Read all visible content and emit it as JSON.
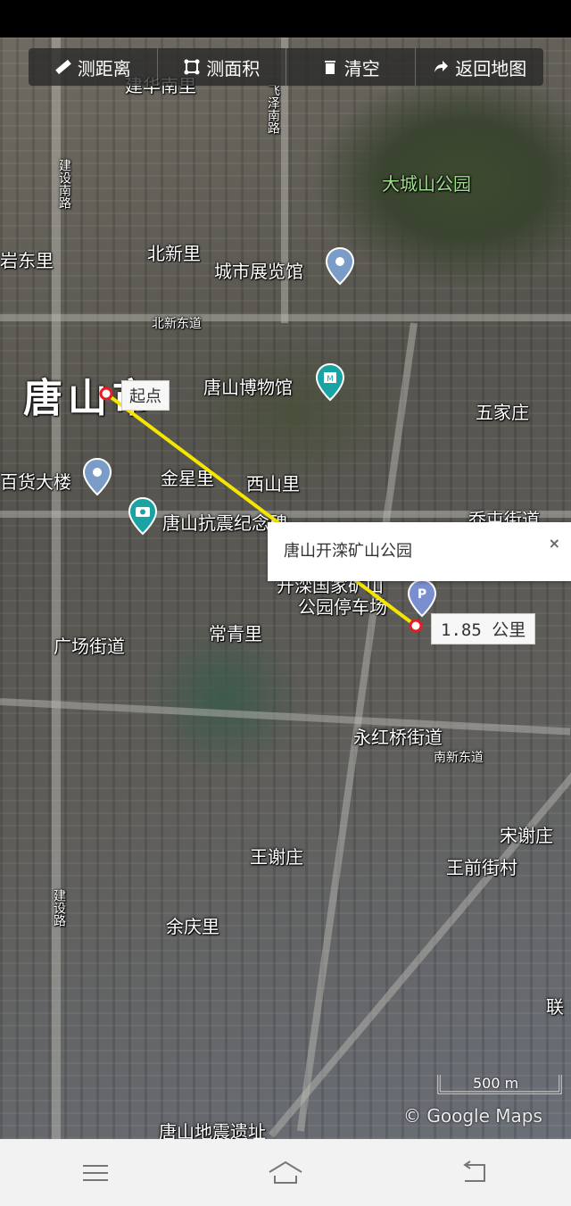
{
  "toolbar": {
    "measure_distance": "测距离",
    "measure_area": "测面积",
    "clear": "清空",
    "back_to_map": "返回地图"
  },
  "map": {
    "labels": {
      "jianhua_nanli": "建华南里",
      "feiyan_nanlu": "飞泽南路",
      "jianshe_nanlu_top": "建设南路",
      "dachengshan_park": "大城山公园",
      "yandong_li": "岩东里",
      "beixin_li": "北新里",
      "city_exhibition_hall": "城市展览馆",
      "beixin_donglu": "北新东道",
      "tangshan_city": "唐山市",
      "tangshan_museum": "唐山博物馆",
      "wujiazhuang": "五家庄",
      "baihuo_dalou": "百货大楼",
      "jinxing_li": "金星里",
      "xishan_li": "西山里",
      "earthquake_memorial": "唐山抗震纪念碑",
      "qiaotun_jiedao": "乔屯街道",
      "park_parking": "开滦国家矿山公园停车场",
      "park_parking_line1": "开滦国家矿山",
      "park_parking_line2": "公园停车场",
      "guangchang_jiedao": "广场街道",
      "changqing_li": "常青里",
      "yonghongqiao_jiedao": "永红桥街道",
      "nanxin_donglu": "南新东道",
      "songxie_zhuang": "宋谢庄",
      "wangxie_zhuang": "王谢庄",
      "wangqian_jiecun": "王前街村",
      "yuqing_li": "余庆里",
      "jianshe_nanlu_bottom": "建设路",
      "lianhe": "联",
      "earthquake_ruins": "唐山地震遗址"
    },
    "start_label": "起点",
    "distance_label": "1.85 公里",
    "popup_title": "唐山开滦矿山公园",
    "popup_close": "×",
    "scale": "500 m",
    "copyright": "© Google Maps"
  },
  "colors": {
    "measure_line": "#f5e600",
    "marker_red": "#e51c23",
    "poi_blue": "#7a9cc6",
    "poi_teal": "#1aa3a3"
  }
}
